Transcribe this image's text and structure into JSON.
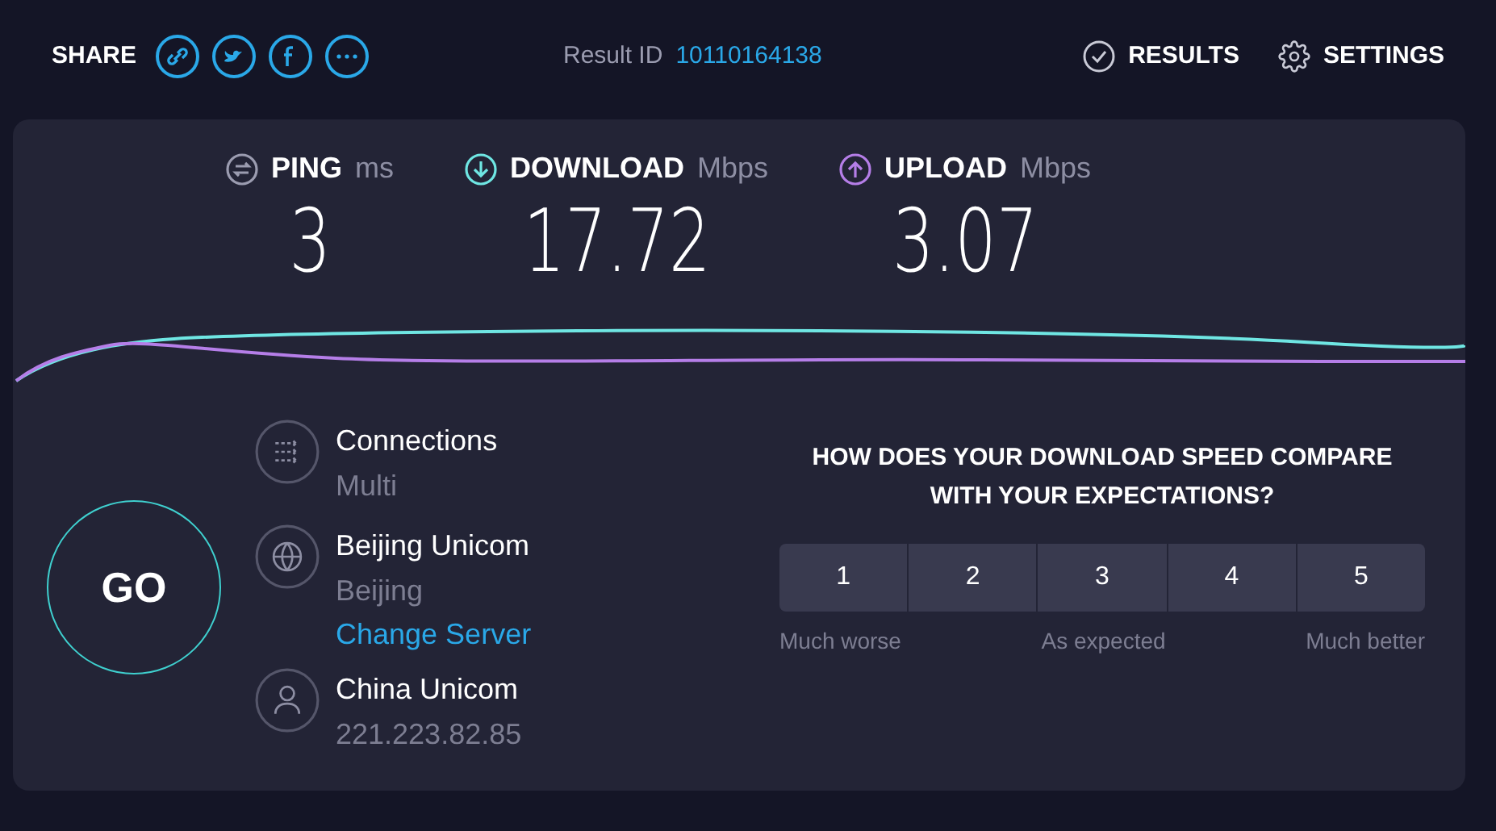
{
  "header": {
    "share_label": "SHARE",
    "result_label": "Result ID",
    "result_id": "10110164138",
    "nav": [
      {
        "kind": "results",
        "label": "RESULTS"
      },
      {
        "kind": "settings",
        "label": "SETTINGS"
      }
    ]
  },
  "metrics": [
    {
      "kind": "ping",
      "label": "PING",
      "unit": "ms",
      "value": "3",
      "color": "#9b9cb0"
    },
    {
      "kind": "download",
      "label": "DOWNLOAD",
      "unit": "Mbps",
      "value": "17.72",
      "color": "#6fe6e3"
    },
    {
      "kind": "upload",
      "label": "UPLOAD",
      "unit": "Mbps",
      "value": "3.07",
      "color": "#b57ee8"
    }
  ],
  "go_button": {
    "label": "GO"
  },
  "info": [
    {
      "kind": "connections",
      "title": "Connections",
      "subtitle": "Multi"
    },
    {
      "kind": "server",
      "title": "Beijing Unicom",
      "subtitle": "Beijing",
      "link": "Change Server"
    },
    {
      "kind": "isp",
      "title": "China Unicom",
      "subtitle": "221.223.82.85"
    }
  ],
  "survey": {
    "question": "HOW DOES YOUR DOWNLOAD SPEED COMPARE WITH YOUR EXPECTATIONS?",
    "options": [
      {
        "label": "1",
        "selected": false
      },
      {
        "label": "2",
        "selected": false
      },
      {
        "label": "3",
        "selected": false
      },
      {
        "label": "4",
        "selected": false
      },
      {
        "label": "5",
        "selected": false
      }
    ],
    "scale_labels": [
      "Much worse",
      "As expected",
      "Much better"
    ]
  }
}
